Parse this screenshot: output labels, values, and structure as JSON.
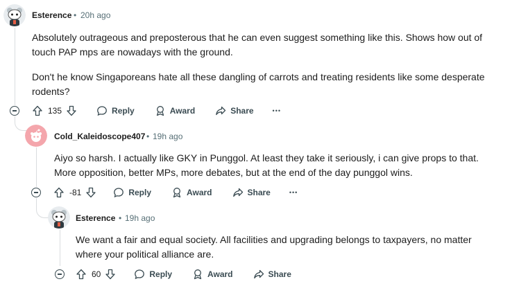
{
  "comments": [
    {
      "username": "Esterence",
      "time": "20h ago",
      "paragraphs": [
        "Absolutely outrageous and preposterous that he can even suggest something like this. Shows how out of touch PAP mps are nowadays with the ground.",
        "Don't he know Singaporeans hate all these dangling of carrots and treating residents like some desperate rodents?"
      ],
      "votes": "135"
    },
    {
      "username": "Cold_Kaleidoscope407",
      "time": "19h ago",
      "paragraphs": [
        "Aiyo so harsh. I actually like GKY in Punggol. At least they take it seriously, i can give props to that. More opposition, better MPs, more debates, but at the end of the day punggol wins."
      ],
      "votes": "-81"
    },
    {
      "username": "Esterence",
      "time": "19h ago",
      "paragraphs": [
        "We want a fair and equal society. All facilities and upgrading belongs to taxpayers, no matter where your political alliance are."
      ],
      "votes": "60"
    }
  ],
  "actions": {
    "reply": "Reply",
    "award": "Award",
    "share": "Share",
    "more": "•••",
    "separator": "•"
  },
  "icons": {
    "collapse": "minus-circle-icon",
    "upvote": "arrow-up-icon",
    "downvote": "arrow-down-icon",
    "reply": "speech-bubble-icon",
    "award": "award-ribbon-icon",
    "share": "share-arrow-icon"
  },
  "colors": {
    "meta": "#576f76",
    "thread_line": "#d9dcde",
    "avatar_pink": "#f4a6ac"
  }
}
